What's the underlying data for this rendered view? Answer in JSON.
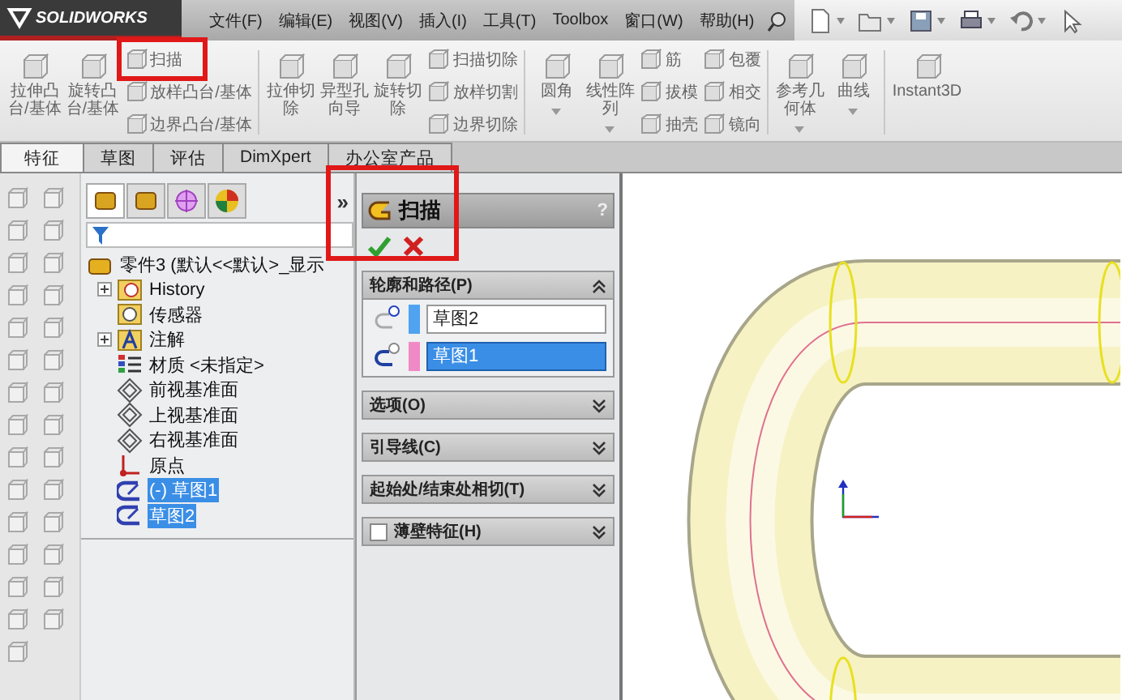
{
  "app": {
    "logo": "SOLIDWORKS"
  },
  "menu": [
    "文件(F)",
    "编辑(E)",
    "视图(V)",
    "插入(I)",
    "工具(T)",
    "Toolbox",
    "窗口(W)",
    "帮助(H)"
  ],
  "ribbon": {
    "groups": [
      {
        "columns": [
          {
            "kind": "large",
            "lines": [
              "拉伸凸",
              "台/基体"
            ],
            "dropdown": false
          },
          {
            "kind": "large",
            "lines": [
              "旋转凸",
              "台/基体"
            ],
            "dropdown": false
          },
          {
            "kind": "stack",
            "items": [
              {
                "label": "扫描",
                "highlighted": true
              },
              {
                "label": "放样凸台/基体",
                "highlighted": false
              },
              {
                "label": "边界凸台/基体",
                "highlighted": false
              }
            ]
          }
        ]
      },
      {
        "columns": [
          {
            "kind": "large",
            "lines": [
              "拉伸切",
              "除"
            ],
            "dropdown": false
          },
          {
            "kind": "large",
            "lines": [
              "异型孔",
              "向导"
            ],
            "dropdown": false
          },
          {
            "kind": "large",
            "lines": [
              "旋转切",
              "除"
            ],
            "dropdown": false
          },
          {
            "kind": "stack",
            "items": [
              {
                "label": "扫描切除",
                "highlighted": false
              },
              {
                "label": "放样切割",
                "highlighted": false
              },
              {
                "label": "边界切除",
                "highlighted": false
              }
            ]
          }
        ]
      },
      {
        "columns": [
          {
            "kind": "large",
            "lines": [
              "圆角"
            ],
            "dropdown": true
          },
          {
            "kind": "large",
            "lines": [
              "线性阵",
              "列"
            ],
            "dropdown": true
          },
          {
            "kind": "stack",
            "items": [
              {
                "label": "筋",
                "highlighted": false
              },
              {
                "label": "拔模",
                "highlighted": false
              },
              {
                "label": "抽壳",
                "highlighted": false
              }
            ]
          },
          {
            "kind": "stack",
            "items": [
              {
                "label": "包覆",
                "highlighted": false
              },
              {
                "label": "相交",
                "highlighted": false
              },
              {
                "label": "镜向",
                "highlighted": false
              }
            ]
          }
        ]
      },
      {
        "columns": [
          {
            "kind": "large",
            "lines": [
              "参考几",
              "何体"
            ],
            "dropdown": true
          },
          {
            "kind": "large",
            "lines": [
              "曲线"
            ],
            "dropdown": true
          }
        ]
      },
      {
        "columns": [
          {
            "kind": "large",
            "lines": [
              "Instant3D"
            ],
            "dropdown": false
          }
        ]
      }
    ]
  },
  "tabs": [
    {
      "label": "特征",
      "selected": true
    },
    {
      "label": "草图",
      "selected": false
    },
    {
      "label": "评估",
      "selected": false
    },
    {
      "label": "DimXpert",
      "selected": false
    },
    {
      "label": "办公室产品",
      "selected": false
    }
  ],
  "feature_tree": {
    "panel_tabs": [
      {
        "selected": true
      },
      {
        "selected": false
      },
      {
        "selected": false
      },
      {
        "selected": false
      }
    ],
    "expand_button": "»",
    "root": "零件3  (默认<<默认>_显示",
    "items": [
      {
        "kind": "history",
        "label": "History",
        "expandable": true,
        "selected": false
      },
      {
        "kind": "sensor",
        "label": "传感器",
        "expandable": false,
        "selected": false
      },
      {
        "kind": "annotation",
        "label": "注解",
        "expandable": true,
        "selected": false
      },
      {
        "kind": "material",
        "label": "材质 <未指定>",
        "expandable": false,
        "selected": false
      },
      {
        "kind": "plane",
        "label": "前视基准面",
        "expandable": false,
        "selected": false
      },
      {
        "kind": "plane",
        "label": "上视基准面",
        "expandable": false,
        "selected": false
      },
      {
        "kind": "plane",
        "label": "右视基准面",
        "expandable": false,
        "selected": false
      },
      {
        "kind": "origin",
        "label": "原点",
        "expandable": false,
        "selected": false
      },
      {
        "kind": "sketch",
        "label": "(-) 草图1",
        "expandable": false,
        "selected": true
      },
      {
        "kind": "sketch",
        "label": "草图2",
        "expandable": false,
        "selected": true
      }
    ]
  },
  "property_manager": {
    "title": "扫描",
    "help": "?",
    "highlighted": true,
    "sections": [
      {
        "kind": "plain",
        "title": "轮廓和路径(P)",
        "expanded": true,
        "fields": [
          {
            "kind": "profile",
            "value": "草图2",
            "color": "#4fa3f0",
            "selected": false
          },
          {
            "kind": "path",
            "value": "草图1",
            "color": "#f08ac6",
            "selected": true
          }
        ]
      },
      {
        "kind": "plain",
        "title": "选项(O)",
        "expanded": false
      },
      {
        "kind": "plain",
        "title": "引导线(C)",
        "expanded": false
      },
      {
        "kind": "plain",
        "title": "起始处/结束处相切(T)",
        "expanded": false
      },
      {
        "kind": "checkbox",
        "title": "薄壁特征(H)",
        "expanded": false,
        "checked": false
      }
    ]
  }
}
